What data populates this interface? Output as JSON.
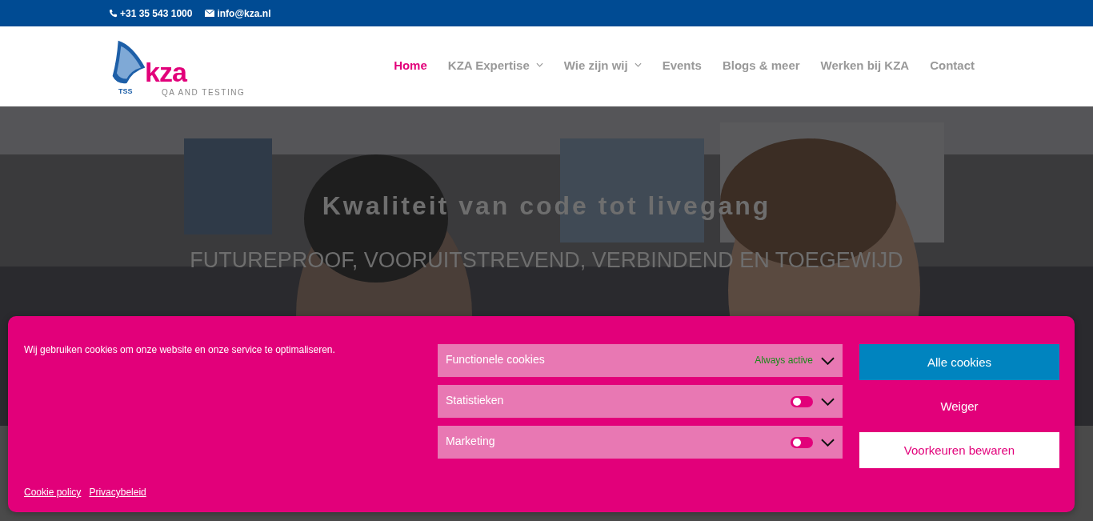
{
  "top_bar": {
    "phone": "+31 35 543 1000",
    "email": "info@kza.nl"
  },
  "logo": {
    "tag": "TSS",
    "name": "kza",
    "tagline": "QA AND TESTING"
  },
  "nav": [
    {
      "label": "Home",
      "selected": true,
      "dropdown": false
    },
    {
      "label": "KZA Expertise",
      "selected": false,
      "dropdown": true
    },
    {
      "label": "Wie zijn wij",
      "selected": false,
      "dropdown": true
    },
    {
      "label": "Events",
      "selected": false,
      "dropdown": false
    },
    {
      "label": "Blogs & meer",
      "selected": false,
      "dropdown": false
    },
    {
      "label": "Werken bij KZA",
      "selected": false,
      "dropdown": false
    },
    {
      "label": "Contact",
      "selected": false,
      "dropdown": false
    }
  ],
  "hero": {
    "title": "Kwaliteit van code tot livegang",
    "subtitle": "FUTUREPROOF, VOORUITSTREVEND, VERBINDEND EN TOEGEWIJD"
  },
  "cookie_banner": {
    "message": "Wij gebruiken cookies om onze website en onze service te optimaliseren.",
    "categories": [
      {
        "label": "Functionele cookies",
        "kind": "always",
        "status": "Always active",
        "expanded": false
      },
      {
        "label": "Statistieken",
        "kind": "toggle",
        "on": false,
        "expanded": false
      },
      {
        "label": "Marketing",
        "kind": "toggle",
        "on": false,
        "expanded": false
      }
    ],
    "buttons": [
      {
        "label": "Alle cookies",
        "kind": "primary"
      },
      {
        "label": "Weiger",
        "kind": "plain"
      },
      {
        "label": "Voorkeuren bewaren",
        "kind": "outline"
      }
    ],
    "links": [
      "Cookie policy",
      "Privacybeleid"
    ]
  }
}
